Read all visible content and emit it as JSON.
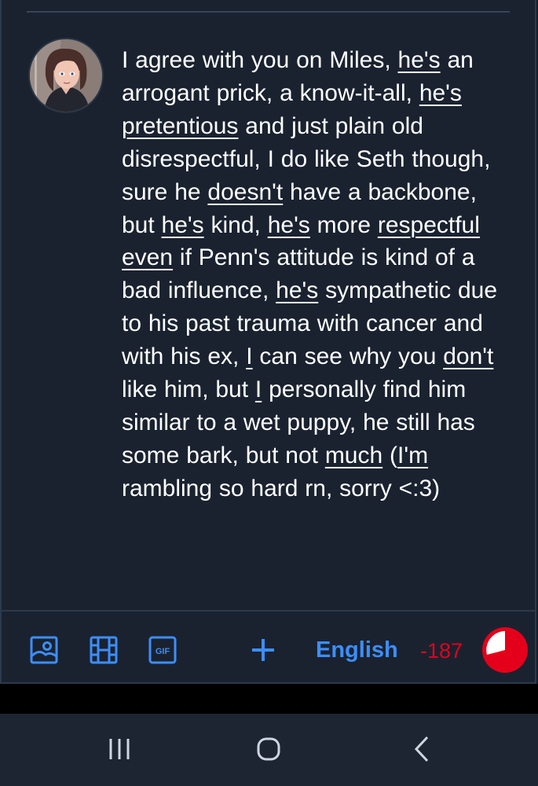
{
  "post": {
    "segments": [
      {
        "t": "I agree with you on Miles, "
      },
      {
        "t": "he's",
        "u": true
      },
      {
        "t": " an arrogant prick, a know-it-all, "
      },
      {
        "t": "he's",
        "u": true
      },
      {
        "t": " "
      },
      {
        "t": "pretentious",
        "u": true
      },
      {
        "t": " and just plain old disrespectful, I do like Seth though, sure he "
      },
      {
        "t": "doesn't",
        "u": true
      },
      {
        "t": " have a backbone, but "
      },
      {
        "t": "he's",
        "u": true
      },
      {
        "t": " kind, "
      },
      {
        "t": "he's",
        "u": true
      },
      {
        "t": " more "
      },
      {
        "t": "respectful",
        "u": true
      },
      {
        "t": " "
      },
      {
        "t": "even",
        "u": true
      },
      {
        "t": " if Penn's attitude is kind of a bad influence, "
      },
      {
        "t": "he's",
        "u": true
      },
      {
        "t": " sympathetic due to his past trauma with cancer and with his ex, "
      },
      {
        "t": "I",
        "u": true
      },
      {
        "t": " can see why you "
      },
      {
        "t": "don't",
        "u": true
      },
      {
        "t": " like him, but "
      },
      {
        "t": "I",
        "u": true
      },
      {
        "t": " personally find him similar to a wet puppy, he still has some bark, but not "
      },
      {
        "t": "much",
        "u": true
      },
      {
        "t": " ("
      },
      {
        "t": "I'm",
        "u": true
      },
      {
        "t": " rambling so hard rn, sorry <:3)"
      }
    ]
  },
  "toolbar": {
    "language": "English",
    "char_count": "-187",
    "overflow_fraction": 1.0,
    "accent_color": "#3d8ef8",
    "error_color": "#e4001a",
    "icons": [
      "image-icon",
      "video-icon",
      "gif-icon",
      "add-icon"
    ],
    "gif_text": "GIF"
  },
  "navbar": {
    "icons": [
      "recents-icon",
      "home-icon",
      "back-icon"
    ]
  }
}
